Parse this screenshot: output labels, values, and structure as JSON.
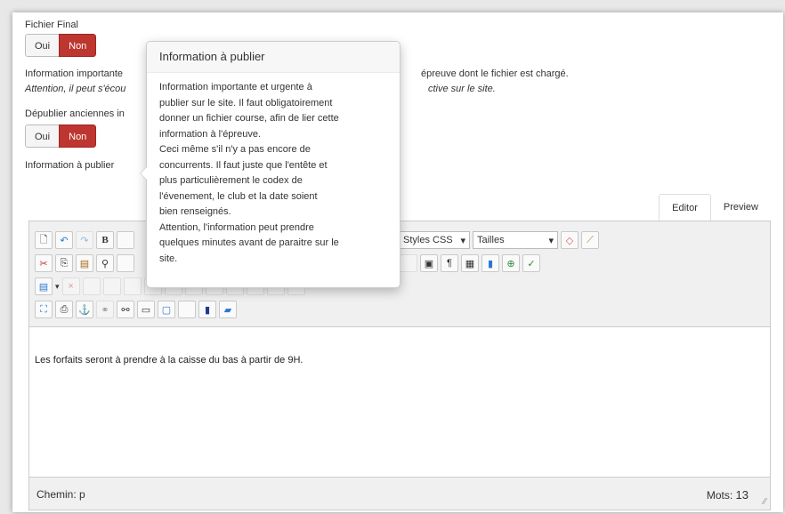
{
  "form": {
    "fichier_final": {
      "label": "Fichier Final",
      "oui": "Oui",
      "non": "Non"
    },
    "info_importante": {
      "label": "Information importante",
      "tail": "épreuve dont le fichier est chargé.",
      "warning": "Attention, il peut s'écou",
      "warning_tail": "ctive sur le site."
    },
    "depublier": {
      "label": "Dépublier anciennes in",
      "oui": "Oui",
      "non": "Non"
    },
    "info_publier_label": "Information à publier"
  },
  "popover": {
    "title": "Information à publier",
    "lines": [
      "Information importante et urgente à",
      "publier sur le site. Il faut obligatoirement",
      "donner un fichier course, afin de lier cette",
      "information à l'épreuve.",
      "Ceci même s'il n'y a pas encore de",
      "concurrents. Il faut juste que l'entête et",
      "plus particulièrement le codex de",
      "l'évenement, le club et la date soient",
      "bien renseignés.",
      "Attention, l'information peut prendre",
      "quelques minutes avant de paraitre sur le",
      "site."
    ]
  },
  "tabs": {
    "editor": "Editor",
    "preview": "Preview"
  },
  "toolbar": {
    "styles_select": "Styles CSS",
    "sizes_select": "Tailles",
    "bold": "B"
  },
  "editor": {
    "content": "Les forfaits seront à prendre à la caisse du bas à partir de 9H.",
    "path_label": "Chemin: p",
    "words_label": "Mots:",
    "words_count": "13"
  },
  "colors": {
    "accent_red": "#bd362f"
  }
}
